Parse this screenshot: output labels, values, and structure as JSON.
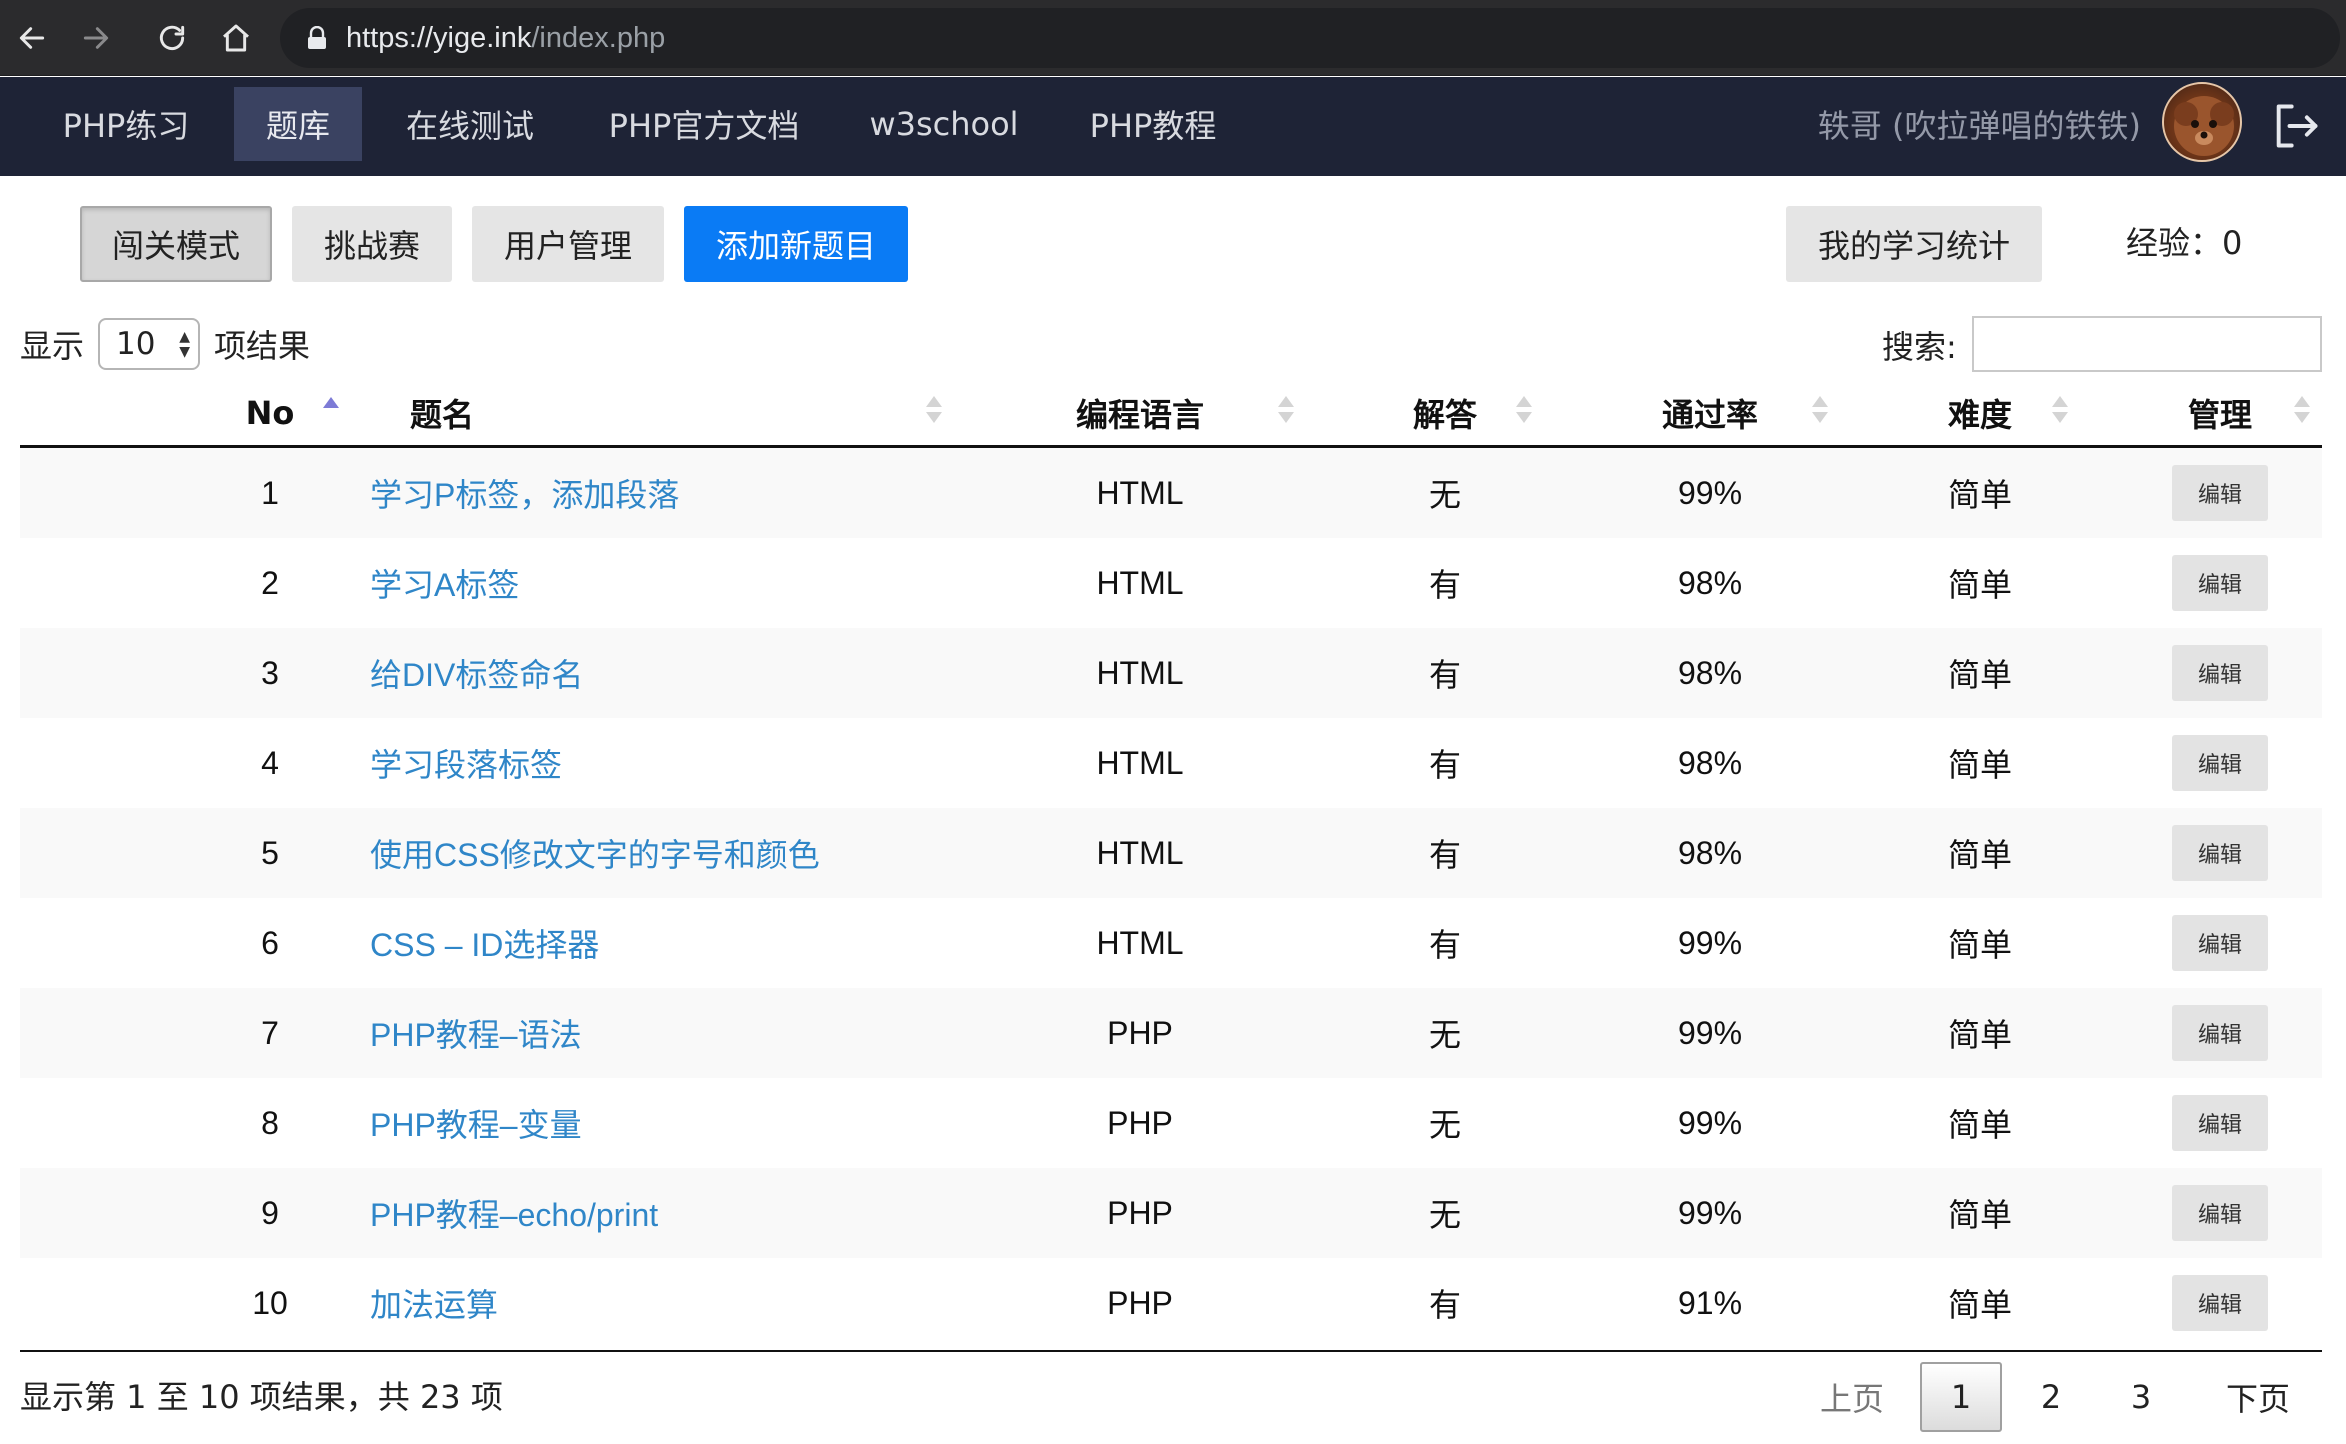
{
  "browser": {
    "url_host": "https://yige.ink",
    "url_path": "/index.php"
  },
  "navbar": {
    "items": [
      {
        "label": "PHP练习"
      },
      {
        "label": "题库"
      },
      {
        "label": "在线测试"
      },
      {
        "label": "PHP官方文档"
      },
      {
        "label": "w3school"
      },
      {
        "label": "PHP教程"
      }
    ],
    "active_item": "题库",
    "user_name": "轶哥 (吹拉弹唱的铁铁)"
  },
  "toolbar": {
    "levels_mode": "闯关模式",
    "challenge": "挑战赛",
    "user_management": "用户管理",
    "add_question": "添加新题目",
    "my_stats": "我的学习统计",
    "experience_label": "经验：",
    "experience_value": "0"
  },
  "table_controls": {
    "show_label": "显示",
    "page_length": "10",
    "results_label": "项结果",
    "search_label": "搜索:",
    "search_value": ""
  },
  "table": {
    "headers": {
      "no": "No",
      "title": "题名",
      "language": "编程语言",
      "answer": "解答",
      "pass_rate": "通过率",
      "difficulty": "难度",
      "manage": "管理"
    },
    "sorted_column": "No",
    "sort_direction": "ascending",
    "rows": [
      {
        "no": "1",
        "title": "学习P标签，添加段落",
        "language": "HTML",
        "answer": "无",
        "pass_rate": "99%",
        "difficulty": "简单",
        "action": "编辑"
      },
      {
        "no": "2",
        "title": "学习A标签",
        "language": "HTML",
        "answer": "有",
        "pass_rate": "98%",
        "difficulty": "简单",
        "action": "编辑"
      },
      {
        "no": "3",
        "title": "给DIV标签命名",
        "language": "HTML",
        "answer": "有",
        "pass_rate": "98%",
        "difficulty": "简单",
        "action": "编辑"
      },
      {
        "no": "4",
        "title": "学习段落标签",
        "language": "HTML",
        "answer": "有",
        "pass_rate": "98%",
        "difficulty": "简单",
        "action": "编辑"
      },
      {
        "no": "5",
        "title": "使用CSS修改文字的字号和颜色",
        "language": "HTML",
        "answer": "有",
        "pass_rate": "98%",
        "difficulty": "简单",
        "action": "编辑"
      },
      {
        "no": "6",
        "title": "CSS – ID选择器",
        "language": "HTML",
        "answer": "有",
        "pass_rate": "99%",
        "difficulty": "简单",
        "action": "编辑"
      },
      {
        "no": "7",
        "title": "PHP教程–语法",
        "language": "PHP",
        "answer": "无",
        "pass_rate": "99%",
        "difficulty": "简单",
        "action": "编辑"
      },
      {
        "no": "8",
        "title": "PHP教程–变量",
        "language": "PHP",
        "answer": "无",
        "pass_rate": "99%",
        "difficulty": "简单",
        "action": "编辑"
      },
      {
        "no": "9",
        "title": "PHP教程–echo/print",
        "language": "PHP",
        "answer": "无",
        "pass_rate": "99%",
        "difficulty": "简单",
        "action": "编辑"
      },
      {
        "no": "10",
        "title": "加法运算",
        "language": "PHP",
        "answer": "有",
        "pass_rate": "91%",
        "difficulty": "简单",
        "action": "编辑"
      }
    ]
  },
  "footer": {
    "info": "显示第 1 至 10 项结果，共 23 项",
    "prev": "上页",
    "pages": [
      "1",
      "2",
      "3"
    ],
    "current_page": "1",
    "next": "下页"
  },
  "colors": {
    "navbar_bg": "#1e2336",
    "navbar_active": "#3a4261",
    "primary": "#0a7bf5",
    "link": "#2f86c8"
  }
}
